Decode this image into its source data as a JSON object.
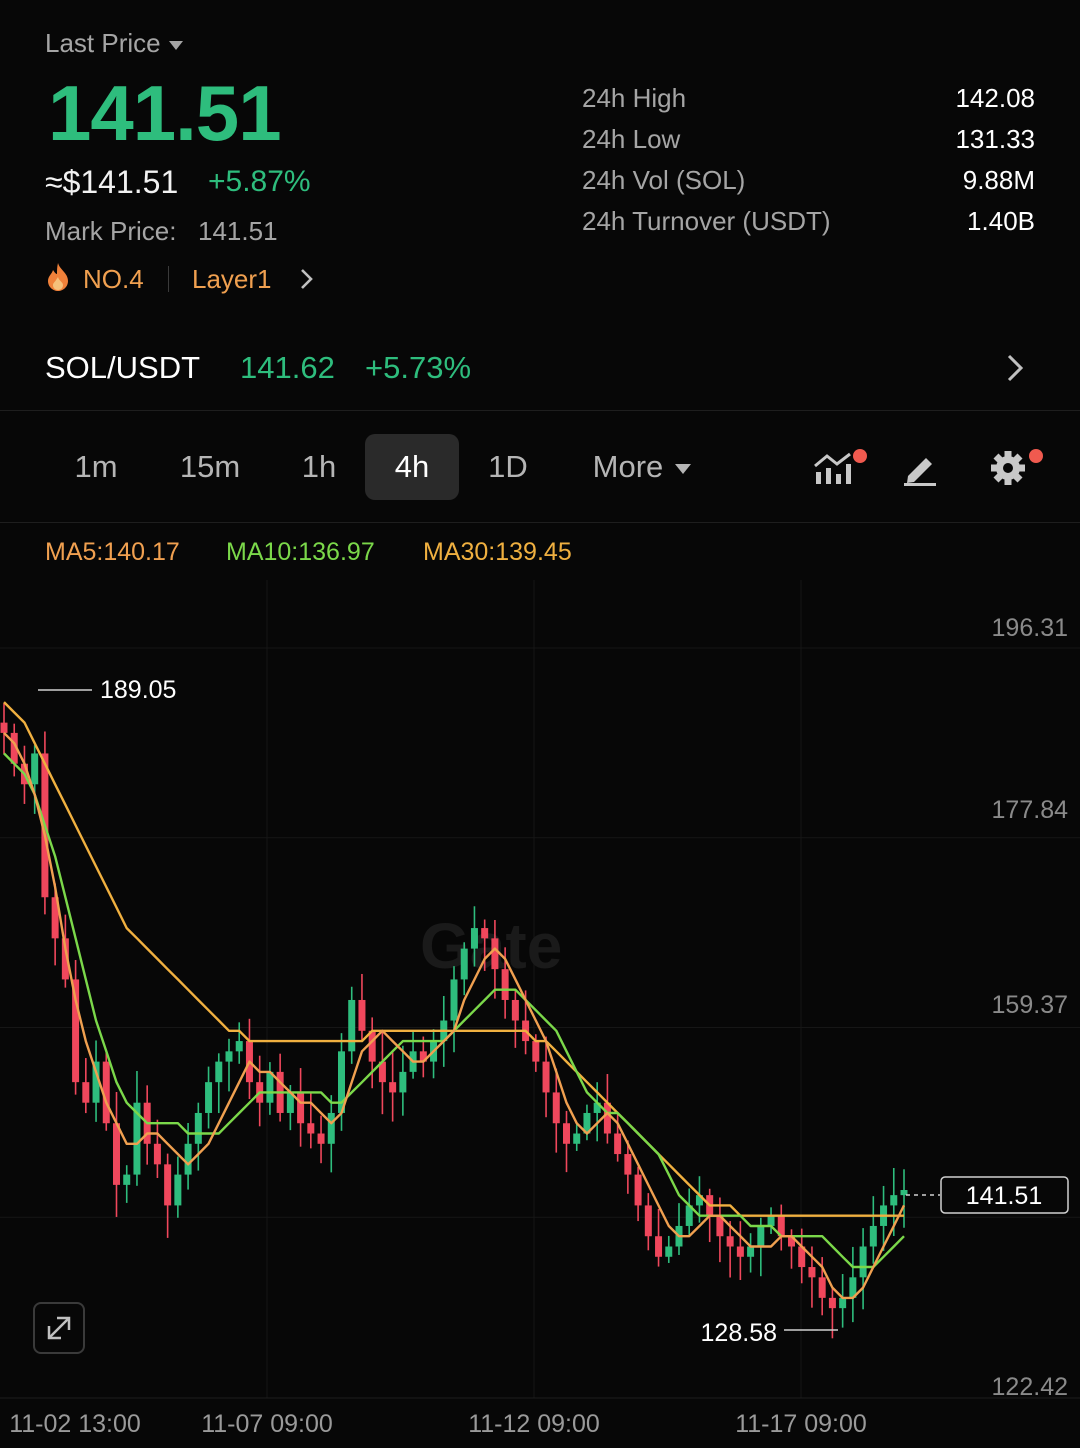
{
  "header": {
    "last_price_label": "Last Price",
    "last_price": "141.51",
    "usd_price": "≈$141.51",
    "change_pct": "+5.87%",
    "mark_price_label": "Mark Price:",
    "mark_price": "141.51",
    "rank": "NO.4",
    "sector": "Layer1"
  },
  "stats": [
    {
      "label": "24h High",
      "value": "142.08"
    },
    {
      "label": "24h Low",
      "value": "131.33"
    },
    {
      "label": "24h Vol (SOL)",
      "value": "9.88M"
    },
    {
      "label": "24h Turnover (USDT)",
      "value": "1.40B"
    }
  ],
  "pair": {
    "name": "SOL/USDT",
    "price": "141.62",
    "change": "+5.73%"
  },
  "intervals": {
    "tabs": [
      "1m",
      "15m",
      "1h",
      "4h",
      "1D"
    ],
    "more": "More",
    "active": "4h"
  },
  "ma": {
    "ma5": "MA5:140.17",
    "ma10": "MA10:136.97",
    "ma30": "MA30:139.45"
  },
  "colors": {
    "up": "#2ebd7d",
    "down": "#f0475c",
    "ma5": "#f0a050",
    "ma10": "#7bd84a",
    "ma30": "#f0b040",
    "accent_dot": "#f05a4f"
  },
  "chart_data": {
    "type": "candlestick",
    "y_ticks": [
      "196.31",
      "177.84",
      "159.37",
      "122.42"
    ],
    "x_ticks": [
      "11-02 13:00",
      "11-07 09:00",
      "11-12 09:00",
      "11-17 09:00"
    ],
    "ylim": [
      122.42,
      196.31
    ],
    "high_marker": "189.05",
    "low_marker": "128.58",
    "current_price_label": "141.51",
    "watermark": "Gate",
    "close_series": [
      186,
      183,
      181,
      184,
      170,
      166,
      162,
      152,
      150,
      154,
      148,
      142,
      143,
      150,
      146,
      144,
      140,
      143,
      146,
      149,
      152,
      154,
      155,
      156,
      152,
      150,
      153,
      149,
      151,
      148,
      147,
      146,
      149,
      155,
      160,
      157,
      154,
      152,
      151,
      153,
      155,
      154,
      156,
      158,
      162,
      165,
      167,
      166,
      163,
      160,
      158,
      156,
      154,
      151,
      148,
      146,
      147,
      149,
      150,
      147,
      145,
      143,
      140,
      137,
      135,
      136,
      138,
      140,
      141,
      139,
      137,
      136,
      135,
      136,
      138,
      139,
      137,
      136,
      134,
      133,
      131,
      130,
      131,
      133,
      136,
      138,
      140,
      141,
      141.5
    ],
    "ma5_series": [
      186,
      185,
      183,
      180,
      176,
      171,
      165,
      160,
      156,
      153,
      150,
      148,
      146,
      146,
      147,
      147,
      146,
      145,
      144,
      145,
      146,
      148,
      150,
      152,
      154,
      153,
      153,
      152,
      151,
      150,
      150,
      149,
      148,
      149,
      152,
      155,
      156,
      157,
      156,
      155,
      154,
      154,
      155,
      156,
      157,
      160,
      162,
      164,
      165,
      164,
      162,
      160,
      158,
      156,
      153,
      150,
      148,
      147,
      148,
      149,
      148,
      146,
      144,
      142,
      140,
      138,
      137,
      137,
      138,
      139,
      139,
      138,
      137,
      136,
      136,
      136,
      137,
      137,
      136,
      135,
      134,
      132,
      131,
      131,
      132,
      134,
      136,
      138,
      140
    ],
    "ma10_series": [
      184,
      183,
      182,
      180,
      177,
      174,
      170,
      166,
      162,
      158,
      155,
      152,
      150,
      149,
      148,
      148,
      148,
      148,
      147,
      147,
      147,
      147,
      148,
      149,
      150,
      151,
      151,
      151,
      151,
      151,
      151,
      151,
      150,
      150,
      151,
      152,
      153,
      154,
      155,
      156,
      156,
      156,
      156,
      156,
      157,
      158,
      159,
      160,
      161,
      161,
      161,
      160,
      159,
      158,
      157,
      155,
      153,
      151,
      150,
      149,
      149,
      148,
      147,
      146,
      145,
      143,
      141,
      140,
      139,
      139,
      139,
      139,
      139,
      138,
      138,
      138,
      137,
      137,
      137,
      137,
      137,
      136,
      135,
      134,
      134,
      134,
      135,
      136,
      137
    ],
    "ma30_series": [
      189,
      188,
      187,
      185,
      183,
      181,
      179,
      177,
      175,
      173,
      171,
      169,
      167,
      166,
      165,
      164,
      163,
      162,
      161,
      160,
      159,
      158,
      157,
      157,
      156,
      156,
      156,
      156,
      156,
      156,
      156,
      156,
      156,
      156,
      156,
      156,
      157,
      157,
      157,
      157,
      157,
      157,
      157,
      157,
      157,
      157,
      157,
      157,
      157,
      157,
      157,
      157,
      156,
      156,
      155,
      154,
      153,
      152,
      151,
      150,
      149,
      148,
      147,
      146,
      145,
      144,
      143,
      142,
      141,
      140,
      140,
      140,
      139,
      139,
      139,
      139,
      139,
      139,
      139,
      139,
      139,
      139,
      139,
      139,
      139,
      139,
      139,
      139,
      139
    ]
  }
}
